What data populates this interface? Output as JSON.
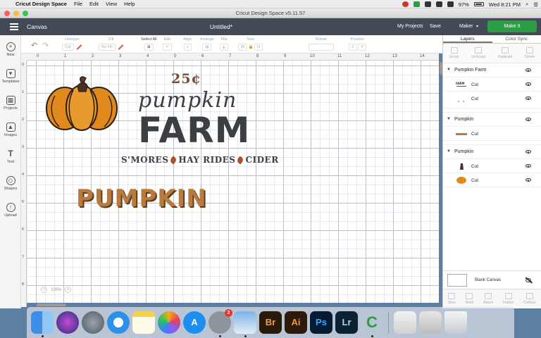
{
  "menubar": {
    "app_name": "Cricut Design Space",
    "items": [
      "File",
      "Edit",
      "View",
      "Help"
    ],
    "battery": "97%",
    "clock": "Wed 8:21 PM"
  },
  "window": {
    "title": "Cricut Design Space  v5.11.57"
  },
  "header": {
    "canvas_label": "Canvas",
    "doc_title": "Untitled*",
    "my_projects": "My Projects",
    "save": "Save",
    "machine": "Maker",
    "make_it": "Make It"
  },
  "toolbar": {
    "linetype_label": "Linetype",
    "linetype_value": "Cut",
    "fill_label": "Fill",
    "fill_value": "No Fill",
    "select_all": "Select All",
    "edit": "Edit",
    "align": "Align",
    "arrange": "Arrange",
    "flip": "Flip",
    "size": "Size",
    "size_w": "W",
    "size_h": "H",
    "rotate": "Rotate",
    "position": "Position",
    "pos_x": "X",
    "pos_y": "Y"
  },
  "leftbar": [
    {
      "label": "New",
      "icon": "plus-circle-icon"
    },
    {
      "label": "Templates",
      "icon": "shirt-icon"
    },
    {
      "label": "Projects",
      "icon": "projects-icon"
    },
    {
      "label": "Images",
      "icon": "images-icon"
    },
    {
      "label": "Text",
      "icon": "text-icon"
    },
    {
      "label": "Shapes",
      "icon": "shapes-icon"
    },
    {
      "label": "Upload",
      "icon": "upload-icon"
    }
  ],
  "ruler": {
    "top": [
      "0",
      "1",
      "2",
      "3",
      "4",
      "5",
      "6",
      "7",
      "8",
      "9",
      "10",
      "11",
      "12",
      "13",
      "14"
    ],
    "left": [
      "0",
      "1",
      "2",
      "3",
      "4",
      "5",
      "6",
      "7",
      "8"
    ]
  },
  "canvas": {
    "zoom": "100%",
    "art": {
      "price": "25¢",
      "script_word": "pumpkin",
      "farm_word": "FARM",
      "tagline_1": "S'MORES",
      "tagline_2": "HAY RIDES",
      "tagline_3": "CIDER",
      "word": "PUMPKIN"
    }
  },
  "panel": {
    "tabs": [
      "Layers",
      "Color Sync"
    ],
    "actions": [
      "Group",
      "UnGroup",
      "Duplicate",
      "Delete"
    ],
    "groups": [
      {
        "name": "Pumpkin Farm",
        "children": [
          "Cut",
          "Cut"
        ]
      },
      {
        "name": "Pumpkin",
        "children": [
          "Cut"
        ]
      },
      {
        "name": "Pumpkin",
        "children": [
          "Cut",
          "Cut"
        ]
      }
    ],
    "blank_canvas": "Blank Canvas",
    "bottom_actions": [
      "Slice",
      "Weld",
      "Attach",
      "Flatten",
      "Contour"
    ]
  },
  "colors": {
    "header_bg": "#414a55",
    "make_it": "#2a9d45",
    "pumpkin_orange": "#e08a1e",
    "farm_text": "#3b3f44",
    "price_brown": "#7a4b3a"
  },
  "dock": {
    "badge": "2",
    "apps": [
      "Finder",
      "Siri",
      "Launchpad",
      "Safari",
      "Notes",
      "Photos",
      "App Store",
      "System Preferences",
      "Preview",
      "Bridge",
      "Illustrator",
      "Photoshop",
      "Lightroom",
      "Cricut",
      "TextEdit",
      "Finder Window",
      "Trash"
    ],
    "labels": {
      "br": "Br",
      "ai": "Ai",
      "ps": "Ps",
      "lr": "Lr"
    }
  }
}
